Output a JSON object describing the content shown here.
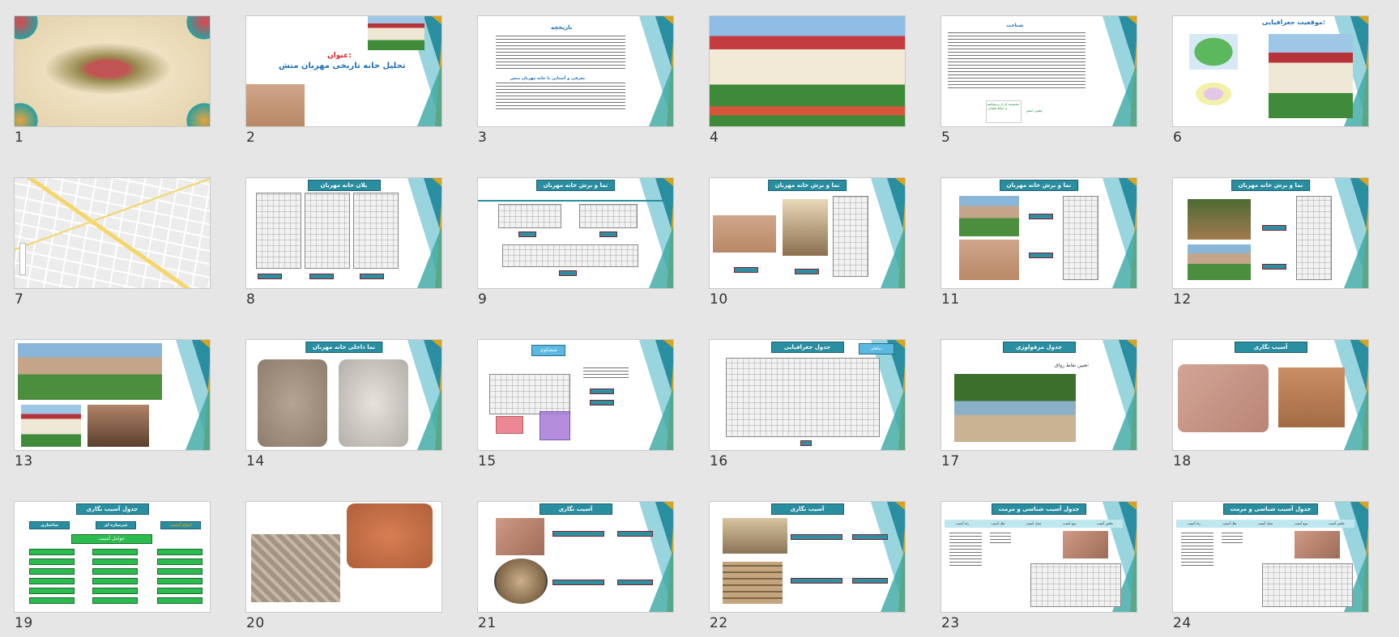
{
  "slides": [
    {
      "number": "1",
      "kind": "calligraphy"
    },
    {
      "number": "2",
      "kind": "title",
      "label": "عنوان:",
      "title": "تحلیل خانه تاریخی مهربان منش"
    },
    {
      "number": "3",
      "kind": "text",
      "heading": "تاریخچه",
      "subheading": "معرفی و آشنایی با خانه مهربان منش"
    },
    {
      "number": "4",
      "kind": "photo"
    },
    {
      "number": "5",
      "kind": "text2",
      "heading": "شناخت",
      "footer_a": "مجموعه ای از پرسپکتیو و خیاط فضایی",
      "footer_b": "پیلوتی اصلی"
    },
    {
      "number": "6",
      "kind": "location",
      "heading": "موقعیت جغرافیایی:"
    },
    {
      "number": "7",
      "kind": "map"
    },
    {
      "number": "8",
      "kind": "plans",
      "bar": "پلان خانه مهربان"
    },
    {
      "number": "9",
      "kind": "elevations",
      "bar": "نما و برش خانه مهربان"
    },
    {
      "number": "10",
      "kind": "mixed",
      "bar": "نما و برش خانه مهربان"
    },
    {
      "number": "11",
      "kind": "mixed2",
      "bar": "نما و برش خانه مهربان"
    },
    {
      "number": "12",
      "kind": "mixed3",
      "bar": "نما و برش خانه مهربان"
    },
    {
      "number": "13",
      "kind": "photos"
    },
    {
      "number": "14",
      "kind": "interior",
      "bar": "نما داخلی خانه مهربان"
    },
    {
      "number": "15",
      "kind": "analysis",
      "tag": "ششکوی"
    },
    {
      "number": "16",
      "kind": "table",
      "bar": "جدول جغرافیایی",
      "tag": "نماهای"
    },
    {
      "number": "17",
      "kind": "morph",
      "bar": "جدول مرفولوژی",
      "caption": "تعیین نقاط رواق:"
    },
    {
      "number": "18",
      "kind": "damage",
      "bar": "آسیب نگاری"
    },
    {
      "number": "19",
      "kind": "damage-table",
      "bar": "جدول آسیب نگاری",
      "tags": [
        "ساختاری",
        "غیرسازه ای",
        "انواع آسیب"
      ],
      "center": "عوامل آسیب"
    },
    {
      "number": "20",
      "kind": "damage-photos"
    },
    {
      "number": "21",
      "kind": "damage2",
      "bar": "آسیب نگاری"
    },
    {
      "number": "22",
      "kind": "damage3",
      "bar": "آسیب نگاری"
    },
    {
      "number": "23",
      "kind": "table2",
      "bar": "جدول آسیب شناسی و مرمت",
      "cols": [
        "عکس آسیب",
        "نوع آسیب",
        "محل آسیب",
        "علل آسیب",
        "راه آسیب"
      ]
    },
    {
      "number": "24",
      "kind": "table2",
      "bar": "جدول آسیب شناسی و مرمت",
      "cols": [
        "عکس آسیب",
        "نوع آسیب",
        "محل آسیب",
        "علل آسیب",
        "راه آسیب"
      ]
    }
  ],
  "colors": {
    "teal": "#2a8ea1",
    "gold": "#d9a418",
    "light_teal": "#7fcad6",
    "green": "#2bbb4f",
    "red_title": "#d9222b",
    "blue_title": "#1e6fb5"
  }
}
